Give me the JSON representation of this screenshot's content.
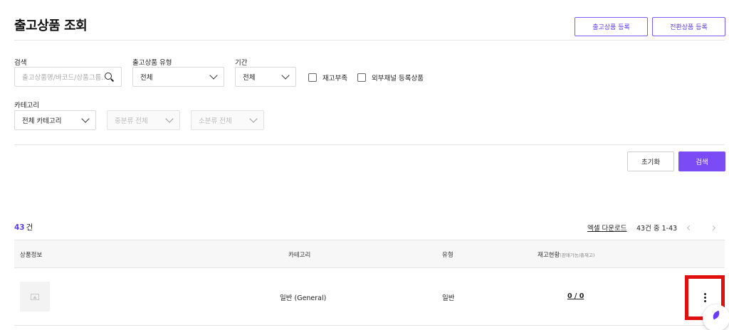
{
  "page": {
    "title": "출고상품 조회"
  },
  "header_actions": {
    "register_label": "출고상품 등록",
    "convert_label": "전환상품 등록"
  },
  "filters": {
    "search": {
      "label": "검색",
      "placeholder": "출고상품명/바코드/상품그룹..."
    },
    "product_type": {
      "label": "출고상품 유형",
      "value": "전체"
    },
    "period": {
      "label": "기간",
      "value": "전체"
    },
    "low_stock_label": "재고부족",
    "external_channel_label": "외부채널 등록상품",
    "category": {
      "label": "카테고리",
      "value": "전체 카테고리",
      "mid_placeholder": "중분류 전체",
      "sub_placeholder": "소분류 전체"
    }
  },
  "actions": {
    "reset_label": "초기화",
    "search_label": "검색"
  },
  "results": {
    "count": "43",
    "count_unit": "건",
    "excel_label": "엑셀 다운로드",
    "pager_info": "43건 중 1-43"
  },
  "table": {
    "headers": {
      "product_info": "상품정보",
      "category": "카테고리",
      "type": "유형",
      "stock": "재고현황",
      "stock_sub": "(판매가능/총재고)"
    },
    "rows": [
      {
        "category": "일반 (General)",
        "type": "일반",
        "stock": "0 / 0"
      }
    ]
  },
  "colors": {
    "accent": "#7b4cf6",
    "highlight": "#e01010"
  }
}
